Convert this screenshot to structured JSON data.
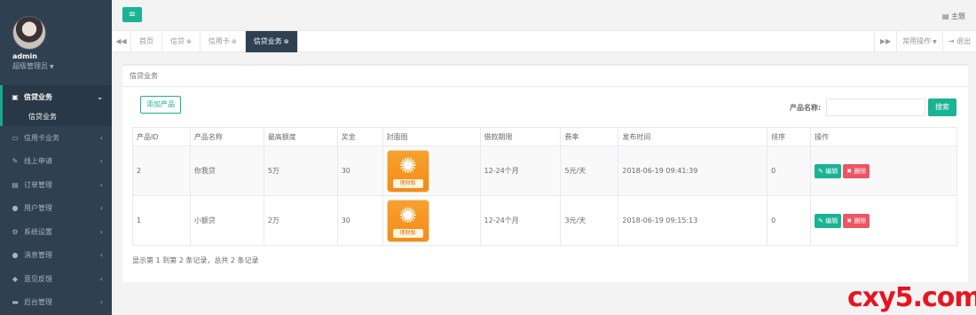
{
  "sidebar": {
    "user": {
      "name": "admin",
      "role": "超级管理员"
    },
    "active_menu": {
      "label": "信贷业务",
      "sub": "信贷业务"
    },
    "items": [
      {
        "label": "信用卡业务",
        "icon": "credit-card-icon",
        "glyph": "▭"
      },
      {
        "label": "线上申请",
        "icon": "edit-icon",
        "glyph": "✎"
      },
      {
        "label": "订单管理",
        "icon": "list-icon",
        "glyph": "▤"
      },
      {
        "label": "用户管理",
        "icon": "user-icon",
        "glyph": "●"
      },
      {
        "label": "系统设置",
        "icon": "gears-icon",
        "glyph": "⚙"
      },
      {
        "label": "消息管理",
        "icon": "comment-icon",
        "glyph": "●"
      },
      {
        "label": "意见反馈",
        "icon": "tag-icon",
        "glyph": "◆"
      },
      {
        "label": "后台管理",
        "icon": "desktop-icon",
        "glyph": "▬"
      }
    ]
  },
  "topbar": {
    "theme_label": "主题"
  },
  "tabs": {
    "items": [
      {
        "label": "首页",
        "closable": false
      },
      {
        "label": "信贷",
        "closable": true
      },
      {
        "label": "信用卡",
        "closable": true
      },
      {
        "label": "信贷业务",
        "closable": true
      }
    ],
    "right": {
      "ops_label": "常用操作",
      "logout_label": "退出"
    }
  },
  "panel": {
    "title": "信贷业务",
    "add_label": "添加产品",
    "search_label": "产品名称:",
    "search_value": "",
    "search_button": "搜索"
  },
  "table": {
    "headers": [
      "产品ID",
      "产品名称",
      "最高额度",
      "奖金",
      "封面图",
      "借款期限",
      "费率",
      "发布时间",
      "排序",
      "操作"
    ],
    "rows": [
      {
        "id": "2",
        "name": "你我贷",
        "limit": "5万",
        "bonus": "30",
        "cover_label": "理财版",
        "term": "12-24个月",
        "rate": "5元/天",
        "time": "2018-06-19 09:41:39",
        "sort": "0"
      },
      {
        "id": "1",
        "name": "小额贷",
        "limit": "2万",
        "bonus": "30",
        "cover_label": "理财版",
        "term": "12-24个月",
        "rate": "3元/天",
        "time": "2018-06-19 09:15:13",
        "sort": "0"
      }
    ],
    "edit_label": "编辑",
    "delete_label": "删除"
  },
  "footer": {
    "info": "显示第 1 到第 2 条记录，总共 2 条记录"
  },
  "watermark": "cxy5.com",
  "colors": {
    "primary": "#1ab394",
    "danger": "#ed5565",
    "sidebar": "#2f4050"
  }
}
